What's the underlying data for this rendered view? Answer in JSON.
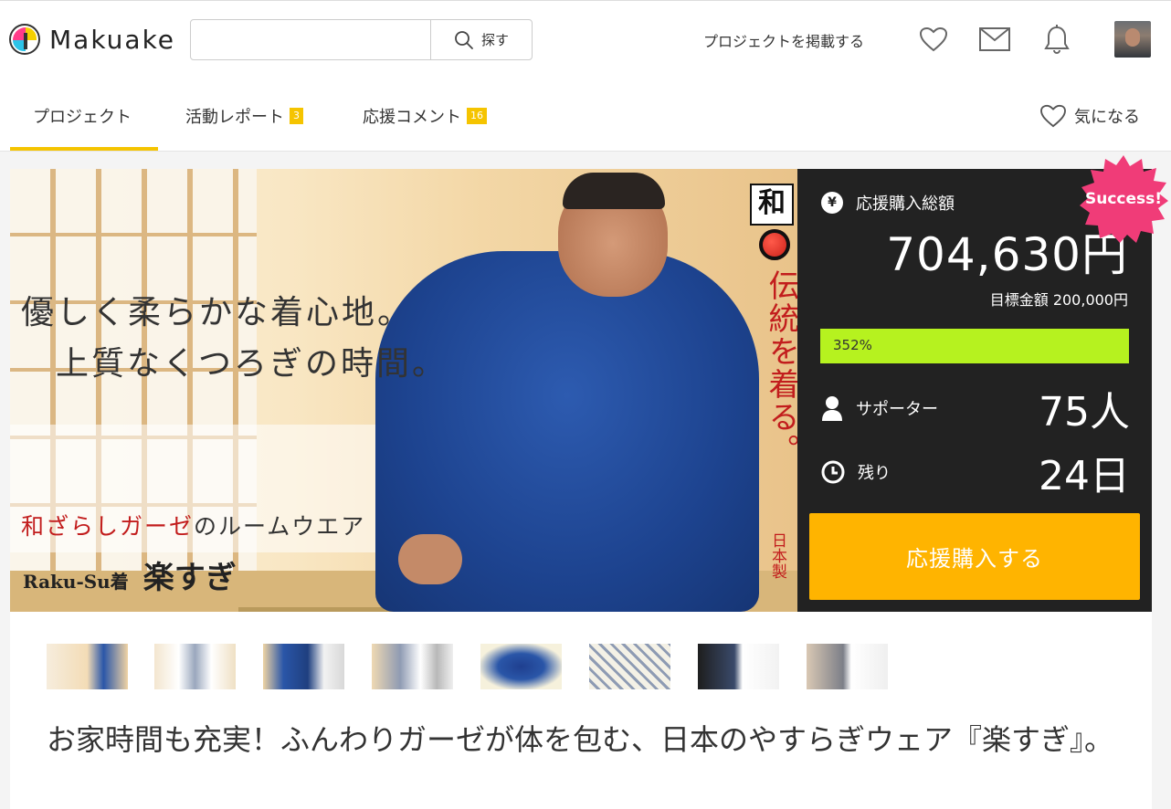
{
  "header": {
    "logo_text": "Makuake",
    "search": {
      "placeholder": "",
      "button_label": "探す"
    },
    "post_project_link": "プロジェクトを掲載する"
  },
  "tabs": [
    {
      "label": "プロジェクト",
      "active": true
    },
    {
      "label": "活動レポート",
      "badge": "3"
    },
    {
      "label": "応援コメント",
      "badge": "16"
    }
  ],
  "follow_label": "気になる",
  "hero": {
    "copy_line1": "優しく柔らかな着心地。",
    "copy_line2": "上質なくつろぎの時間。",
    "sub_red": "和ざらしガーゼ",
    "sub_rest": "のルームウエア",
    "brand_small": "Raku-Su着",
    "brand_big": "楽すぎ",
    "stamp": "和",
    "vertical_1": "伝統を着る。",
    "vertical_2": "日本製"
  },
  "funding": {
    "total_label": "応援購入総額",
    "total_amount": "704,630円",
    "goal": "目標金額 200,000円",
    "progress_text": "352%",
    "progress_fraction": 1.0,
    "supporters_label": "サポーター",
    "supporters_value": "75人",
    "remaining_label": "残り",
    "remaining_value": "24日",
    "buy_label": "応援購入する",
    "badge": "Success!"
  },
  "colors": {
    "accent": "#f5c400",
    "progress": "#b6f21f",
    "buy_button": "#ffb400",
    "success_badge": "#f03c78",
    "panel_bg": "#222222"
  },
  "thumbnails": [
    {
      "name": "thumb-1"
    },
    {
      "name": "thumb-2"
    },
    {
      "name": "thumb-3"
    },
    {
      "name": "thumb-4"
    },
    {
      "name": "thumb-5"
    },
    {
      "name": "thumb-6"
    },
    {
      "name": "thumb-7"
    },
    {
      "name": "thumb-8"
    }
  ],
  "project_title": "お家時間も充実！ふんわりガーゼが体を包む、日本のやすらぎウェア『楽すぎ』。"
}
